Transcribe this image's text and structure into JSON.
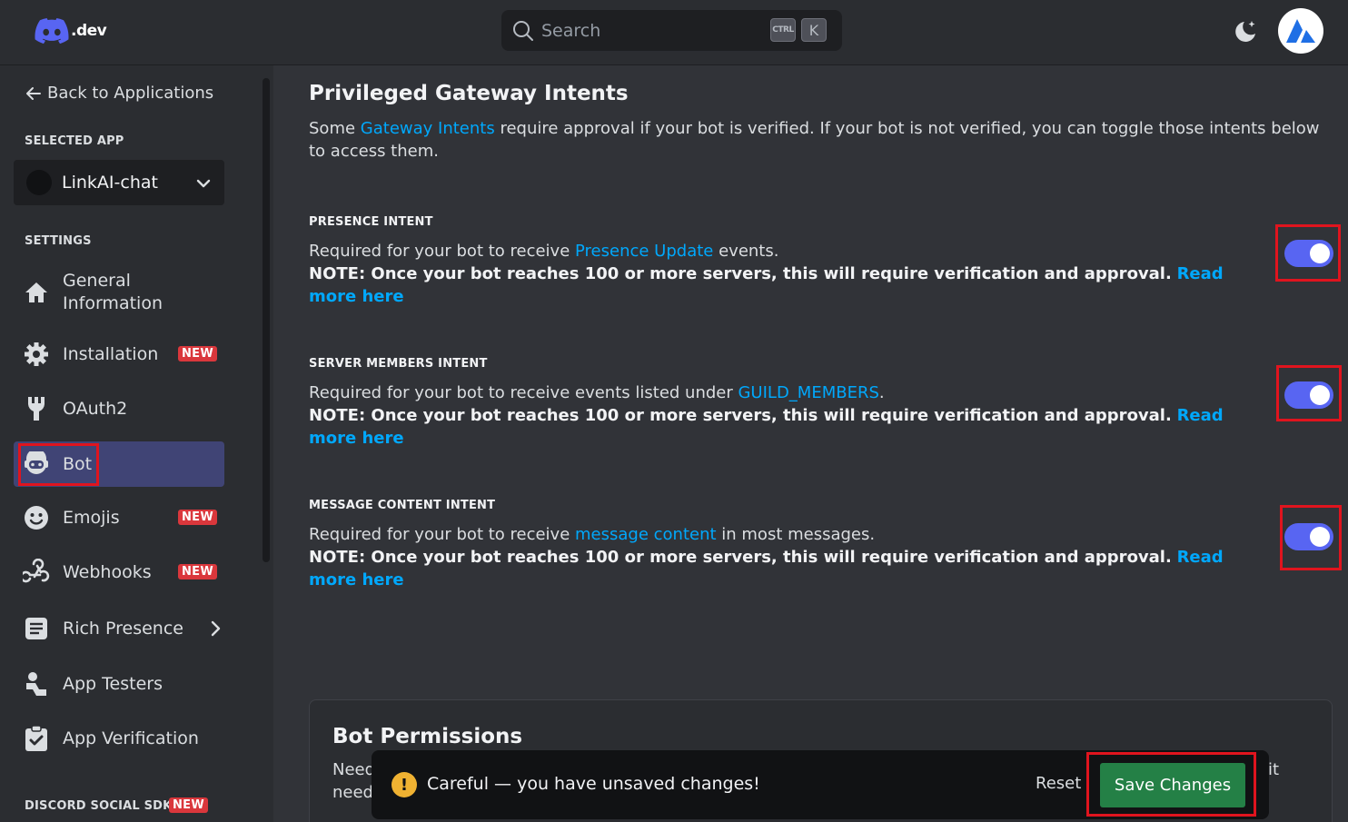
{
  "header": {
    "logo_text": ".dev",
    "search_placeholder": "Search",
    "shortcut_ctrl": "CTRL",
    "shortcut_k": "K"
  },
  "sidebar": {
    "back_label": "Back to Applications",
    "selected_app_heading": "SELECTED APP",
    "selected_app": "LinkAI-chat",
    "settings_heading": "SETTINGS",
    "items": [
      {
        "label": "General Information",
        "icon": "home-icon"
      },
      {
        "label": "Installation",
        "icon": "gear-icon",
        "badge": "NEW"
      },
      {
        "label": "OAuth2",
        "icon": "wrench-icon"
      },
      {
        "label": "Bot",
        "icon": "bot-icon",
        "active": true
      },
      {
        "label": "Emojis",
        "icon": "emoji-icon",
        "badge": "NEW"
      },
      {
        "label": "Webhooks",
        "icon": "webhook-icon",
        "badge": "NEW"
      },
      {
        "label": "Rich Presence",
        "icon": "document-icon"
      },
      {
        "label": "App Testers",
        "icon": "user-icon"
      },
      {
        "label": "App Verification",
        "icon": "clipboard-check-icon"
      }
    ],
    "social_sdk_heading": "DISCORD SOCIAL SDK",
    "social_sdk_badge": "NEW"
  },
  "main": {
    "title": "Privileged Gateway Intents",
    "desc_pre": "Some ",
    "desc_link": "Gateway Intents",
    "desc_post": " require approval if your bot is verified. If your bot is not verified, you can toggle those intents below to access them.",
    "note": "NOTE: Once your bot reaches 100 or more servers, this will require verification and approval.",
    "read_more": "Read more here",
    "intents": [
      {
        "label": "PRESENCE INTENT",
        "pre": "Required for your bot to receive ",
        "link": "Presence Update",
        "post": " events.",
        "enabled": true
      },
      {
        "label": "SERVER MEMBERS INTENT",
        "pre": "Required for your bot to receive events listed under ",
        "link": "GUILD_MEMBERS",
        "post": ".",
        "enabled": true
      },
      {
        "label": "MESSAGE CONTENT INTENT",
        "pre": "Required for your bot to receive ",
        "link": "message content",
        "post": " in most messages.",
        "enabled": true
      }
    ]
  },
  "permissions": {
    "title": "Bot Permissions",
    "frag1": "Need",
    "frag2": "need",
    "frag3": "it"
  },
  "savebar": {
    "message": "Careful — you have unsaved changes!",
    "reset_label": "Reset",
    "save_label": "Save Changes"
  },
  "colors": {
    "accent": "#5865f2",
    "link": "#00a8fc",
    "badge": "#da373c",
    "save": "#248046",
    "highlight": "#e0141e"
  }
}
